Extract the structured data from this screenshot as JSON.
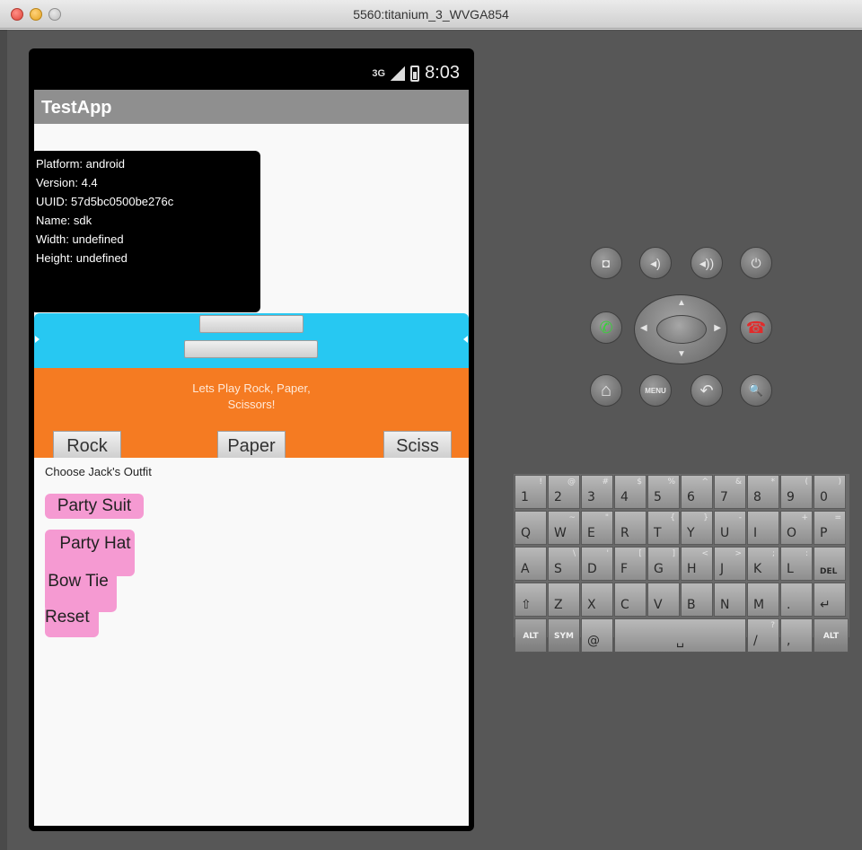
{
  "window": {
    "title": "5560:titanium_3_WVGA854"
  },
  "statusbar": {
    "network": "3G",
    "time": "8:03"
  },
  "app": {
    "title": "TestApp",
    "device_info": [
      "Platform: android",
      "Version: 4.4",
      "UUID: 57d5bc0500be276c",
      "Name: sdk",
      "Width: undefined",
      "Height: undefined"
    ],
    "game_prompt": "Lets Play Rock, Paper, Scissors!",
    "buttons": {
      "rock": "Rock",
      "paper": "Paper",
      "scissors": "Sciss"
    },
    "outfit_label": "Choose Jack's Outfit",
    "outfit_buttons": {
      "party_suit": "Party Suit",
      "party_hat": "Party Hat",
      "bow_tie": "Bow Tie",
      "reset": "Reset"
    }
  },
  "controls": {
    "camera": "◘",
    "vol_down": "◂)",
    "vol_up": "◂))",
    "power": "⏻",
    "call": "✆",
    "end_call": "☎",
    "home": "⌂",
    "menu": "MENU",
    "back": "↶",
    "search": "🔍"
  },
  "keyboard": {
    "row1": [
      {
        "k": "1",
        "a": "!"
      },
      {
        "k": "2",
        "a": "@"
      },
      {
        "k": "3",
        "a": "#"
      },
      {
        "k": "4",
        "a": "$"
      },
      {
        "k": "5",
        "a": "%"
      },
      {
        "k": "6",
        "a": "^"
      },
      {
        "k": "7",
        "a": "&"
      },
      {
        "k": "8",
        "a": "*"
      },
      {
        "k": "9",
        "a": "("
      },
      {
        "k": "0",
        "a": ")"
      }
    ],
    "row2": [
      {
        "k": "Q",
        "a": ""
      },
      {
        "k": "W",
        "a": "~"
      },
      {
        "k": "E",
        "a": "\""
      },
      {
        "k": "R",
        "a": ""
      },
      {
        "k": "T",
        "a": "{"
      },
      {
        "k": "Y",
        "a": "}"
      },
      {
        "k": "U",
        "a": "-"
      },
      {
        "k": "I",
        "a": ""
      },
      {
        "k": "O",
        "a": "+"
      },
      {
        "k": "P",
        "a": "="
      }
    ],
    "row3": [
      {
        "k": "A",
        "a": ""
      },
      {
        "k": "S",
        "a": "\\"
      },
      {
        "k": "D",
        "a": "'"
      },
      {
        "k": "F",
        "a": "["
      },
      {
        "k": "G",
        "a": "]"
      },
      {
        "k": "H",
        "a": "<"
      },
      {
        "k": "J",
        "a": ">"
      },
      {
        "k": "K",
        "a": ";"
      },
      {
        "k": "L",
        "a": ":"
      },
      {
        "k": "DEL",
        "a": ""
      }
    ],
    "row4": [
      {
        "k": "⇧",
        "a": ""
      },
      {
        "k": "Z",
        "a": ""
      },
      {
        "k": "X",
        "a": ""
      },
      {
        "k": "C",
        "a": ""
      },
      {
        "k": "V",
        "a": ""
      },
      {
        "k": "B",
        "a": ""
      },
      {
        "k": "N",
        "a": ""
      },
      {
        "k": "M",
        "a": ""
      },
      {
        "k": ".",
        "a": ""
      },
      {
        "k": "↵",
        "a": ""
      }
    ],
    "row5": {
      "alt_left": "ALT",
      "sym": "SYM",
      "at": "@",
      "space": "␣",
      "slash": "/",
      "slash_alt": "?",
      "comma": ",",
      "alt_right": "ALT"
    }
  }
}
